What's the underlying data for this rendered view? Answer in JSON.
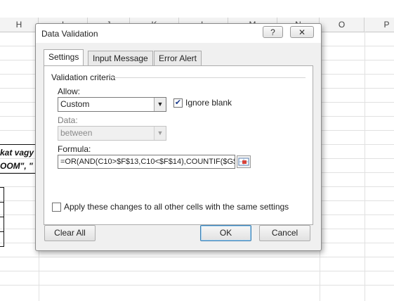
{
  "sheet": {
    "columns": [
      {
        "label": "H"
      },
      {
        "label": "I"
      },
      {
        "label": "J"
      },
      {
        "label": "K"
      },
      {
        "label": "L"
      },
      {
        "label": "M"
      },
      {
        "label": "N"
      },
      {
        "label": "O"
      },
      {
        "label": "P"
      }
    ],
    "cell_text_1": "kat vagy",
    "cell_text_2": "OOM\", \""
  },
  "dialog": {
    "title": "Data Validation",
    "help_label": "?",
    "close_label": "✕",
    "tabs": [
      {
        "label": "Settings"
      },
      {
        "label": "Input Message"
      },
      {
        "label": "Error Alert"
      }
    ],
    "group_label": "Validation criteria",
    "allow": {
      "label": "Allow:",
      "value": "Custom"
    },
    "ignore_blank": {
      "label": "Ignore blank",
      "checked": true
    },
    "data": {
      "label": "Data:",
      "value": "between"
    },
    "formula": {
      "label": "Formula:",
      "value": "=OR(AND(C10>$F$13,C10<$F$14),COUNTIF($G$"
    },
    "apply_all": {
      "label": "Apply these changes to all other cells with the same settings",
      "checked": false
    },
    "buttons": {
      "clear_all": "Clear All",
      "ok": "OK",
      "cancel": "Cancel"
    }
  }
}
